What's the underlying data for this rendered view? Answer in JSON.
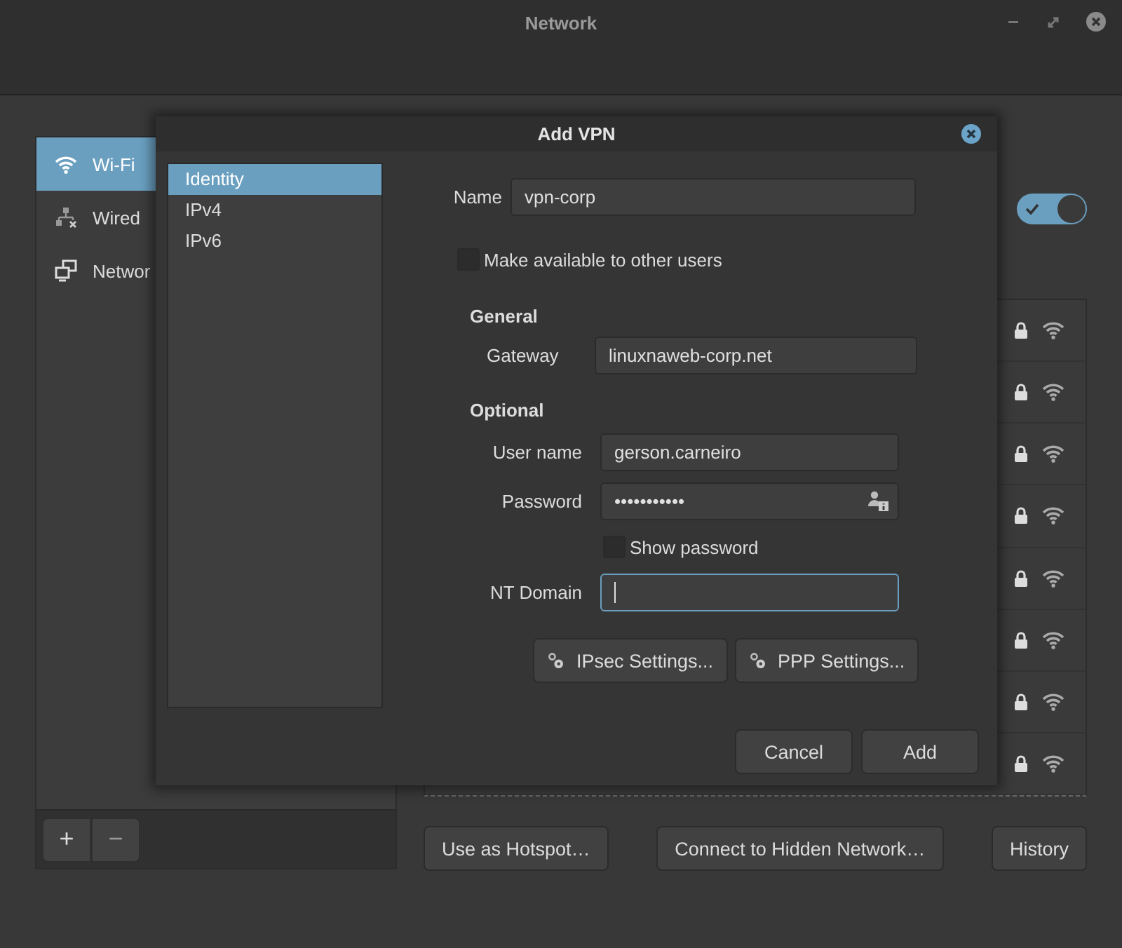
{
  "window": {
    "title": "Network"
  },
  "sidebar": {
    "items": [
      {
        "label": "Wi-Fi",
        "kind": "wifi",
        "selected": true
      },
      {
        "label": "Wired",
        "kind": "wired",
        "selected": false
      },
      {
        "label": "Networ",
        "kind": "network",
        "selected": false
      }
    ],
    "buttons": [
      "+",
      "−"
    ]
  },
  "wifi_switch": {
    "on": true
  },
  "networks": [
    {
      "secured": true
    },
    {
      "secured": true
    },
    {
      "secured": true
    },
    {
      "secured": true
    },
    {
      "secured": true
    },
    {
      "secured": true
    },
    {
      "secured": true
    },
    {
      "secured": true
    }
  ],
  "actions": [
    "Use as Hotspot…",
    "Connect to Hidden Network…",
    "History"
  ],
  "dialog": {
    "title": "Add VPN",
    "pages": [
      {
        "label": "Identity",
        "selected": true
      },
      {
        "label": "IPv4",
        "selected": false
      },
      {
        "label": "IPv6",
        "selected": false
      }
    ],
    "name": {
      "label": "Name",
      "value": "vpn-corp"
    },
    "share": {
      "label": "Make available to other users",
      "checked": false
    },
    "sections": [
      {
        "heading": "General",
        "fields": [
          {
            "kind": "text",
            "label": "Gateway",
            "value": "linuxnaweb-corp.net",
            "focused": false
          }
        ]
      },
      {
        "heading": "Optional",
        "fields": [
          {
            "kind": "text",
            "label": "User name",
            "value": "gerson.carneiro",
            "focused": false
          },
          {
            "kind": "password",
            "label": "Password",
            "value": "•••••••••••",
            "focused": false
          },
          {
            "kind": "checkbox",
            "label": "Show password",
            "checked": false
          },
          {
            "kind": "text",
            "label": "NT Domain",
            "focused": true
          }
        ]
      }
    ],
    "setting_buttons": [
      "IPsec Settings...",
      "PPP Settings..."
    ],
    "buttons": [
      "Cancel",
      "Add"
    ]
  }
}
